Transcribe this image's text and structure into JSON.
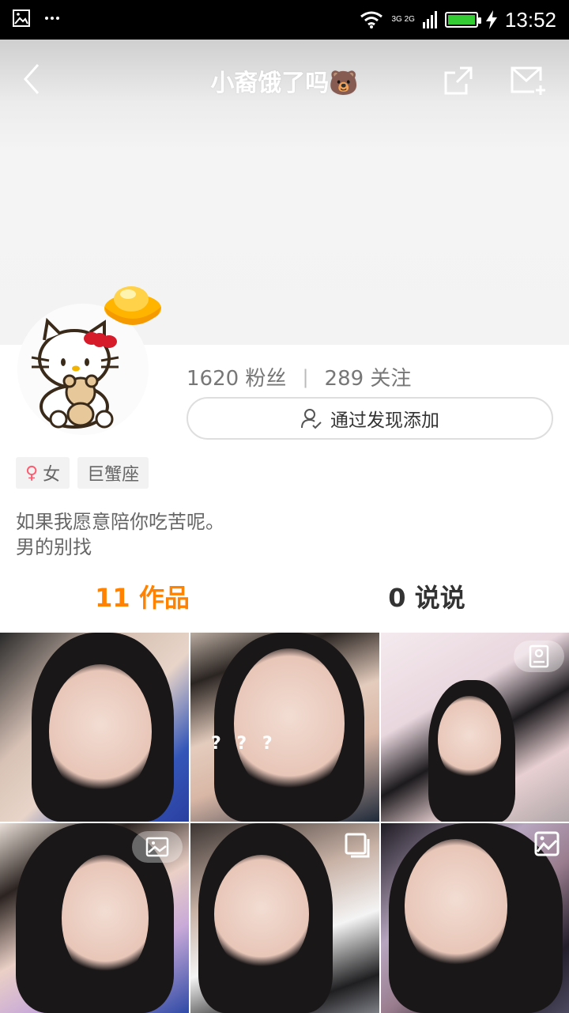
{
  "status_bar": {
    "time": "13:52",
    "network": "3G 2G",
    "battery_level": 0.9
  },
  "nav": {
    "title": "小裔饿了吗🐻"
  },
  "profile": {
    "fans_count": "1620 粉丝",
    "following_count": "289 关注",
    "add_button_label": "通过发现添加",
    "gender_symbol": "♀",
    "gender": "女",
    "zodiac": "巨蟹座",
    "bio_lines": [
      "如果我愿意陪你吃苦呢。",
      "男的别找"
    ]
  },
  "tabs": {
    "works": "11 作品",
    "posts": "0 说说"
  },
  "grid": {
    "overlay_text": "? ? ?"
  },
  "colors": {
    "accent": "#ff8200",
    "battery": "#33cc33",
    "gender": "#ff5a6e"
  },
  "icons": [
    "gallery-icon",
    "more-icon",
    "wifi-icon",
    "signal-icon",
    "battery-icon",
    "charging-icon",
    "back-icon",
    "share-icon",
    "message-icon",
    "gold-ingot-icon",
    "add-friend-icon",
    "image-badge-icon"
  ]
}
